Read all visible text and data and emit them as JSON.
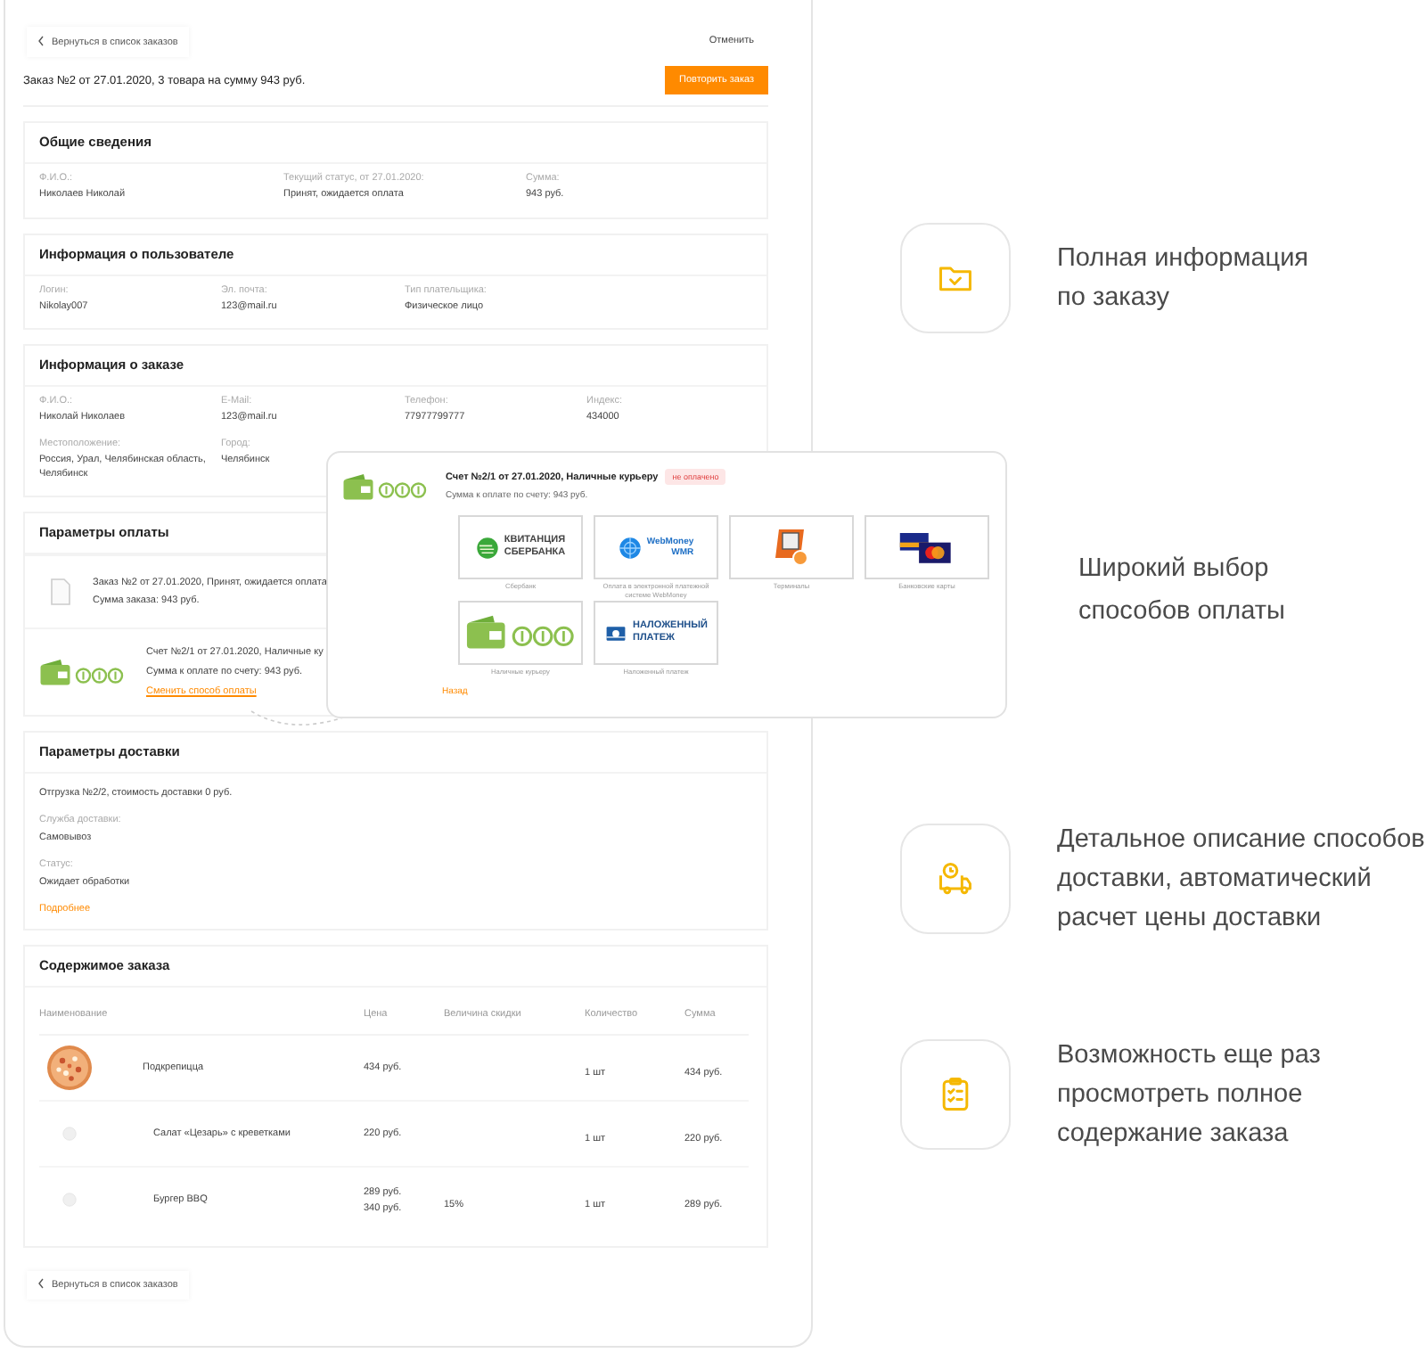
{
  "top_bar": {
    "back_link": "Вернуться в список заказов",
    "cancel_link": "Отменить"
  },
  "order_header": {
    "title": "Заказ №2 от 27.01.2020, 3 товара на сумму 943 руб.",
    "repeat_button": "Повторить заказ"
  },
  "sections": [
    {
      "kind": "summary",
      "title": "Общие сведения",
      "rows": [
        [
          {
            "label": "Ф.И.О.:",
            "value": "Николаев Николай"
          },
          {
            "label": "Текущий статус, от 27.01.2020:",
            "value": "Принят, ожидается оплата"
          },
          {
            "label": "Сумма:",
            "value": "943 руб."
          }
        ]
      ]
    },
    {
      "kind": "fields",
      "title": "Информация о пользователе",
      "rows": [
        [
          {
            "label": "Логин:",
            "value": "Nikolay007"
          },
          {
            "label": "Эл. почта:",
            "value": "123@mail.ru"
          },
          {
            "label": "Тип плательщика:",
            "value": "Физическое лицо"
          }
        ]
      ]
    },
    {
      "kind": "fields",
      "title": "Информация о заказе",
      "rows": [
        [
          {
            "label": "Ф.И.О.:",
            "value": "Николай Николаев"
          },
          {
            "label": "E-Mail:",
            "value": "123@mail.ru"
          },
          {
            "label": "Телефон:",
            "value": "77977799777"
          },
          {
            "label": "Индекс:",
            "value": "434000"
          }
        ],
        [
          {
            "label": "Местоположение:",
            "value": "Россия, Урал, Челябинская область, Челябинск"
          },
          {
            "label": "Город:",
            "value": "Челябинск"
          }
        ]
      ]
    },
    {
      "kind": "payment",
      "title": "Параметры оплаты",
      "entries": [
        {
          "kind": "document",
          "lines": [
            "Заказ №2 от 27.01.2020, Принят, ожидается оплата",
            "Сумма заказа: 943 руб."
          ]
        },
        {
          "kind": "cash",
          "lines": [
            "Счет №2/1 от 27.01.2020, Наличные ку",
            "Сумма к оплате по счету: 943 руб."
          ],
          "link": "Сменить способ оплаты"
        }
      ]
    },
    {
      "kind": "delivery",
      "title": "Параметры доставки",
      "shipment": "Отгрузка №2/2, стоимость доставки 0 руб.",
      "fields": [
        {
          "label": "Служба доставки:",
          "value": "Самовывоз"
        },
        {
          "label": "Статус:",
          "value": "Ожидает обработки"
        }
      ],
      "link": "Подробнее"
    },
    {
      "kind": "items",
      "title": "Содержимое заказа",
      "columns": [
        "Наименование",
        "Цена",
        "Величина скидки",
        "Количество",
        "Сумма"
      ],
      "rows": [
        {
          "name": "Подкрепицца",
          "prices": [
            "434 руб."
          ],
          "quantity": "1 шт",
          "sum": "434 руб."
        },
        {
          "kind": "placeholder",
          "name": "Салат «Цезарь» с креветками",
          "prices": [
            "220 руб."
          ],
          "quantity": "1 шт",
          "sum": "220 руб."
        },
        {
          "kind": "placeholder",
          "name": "Бургер BBQ",
          "prices": [
            "289 руб.",
            "340 руб."
          ],
          "discount": "15%",
          "quantity": "1 шт",
          "sum": "289 руб."
        }
      ]
    }
  ],
  "bottom_back_link": "Вернуться в список заказов",
  "payment_popup": {
    "title": "Счет №2/1 от 27.01.2020, Наличные курьеру",
    "status": "не оплачено",
    "amount": "Сумма к оплате по счету: 943 руб.",
    "methods": [
      {
        "kind": "sberbank",
        "logo_text": [
          "КВИТАНЦИЯ",
          "СБЕРБАНКА"
        ],
        "caption": "Сбербанк"
      },
      {
        "kind": "webmoney",
        "logo_text": [
          "WebMoney",
          "WMR"
        ],
        "caption": "Оплата в электронной платежной системе WebMoney"
      },
      {
        "kind": "terminal",
        "caption": "Терминалы"
      },
      {
        "kind": "cards",
        "caption": "Банковские карты"
      },
      {
        "kind": "cash",
        "caption": "Наличные курьеру"
      },
      {
        "kind": "cod",
        "logo_text": [
          "НАЛОЖЕННЫЙ",
          "ПЛАТЕЖ"
        ],
        "caption": "Наложенный платеж"
      }
    ],
    "back_link": "Назад"
  },
  "features": [
    {
      "kind": "folder",
      "lines": [
        "Полная информация",
        "по заказу"
      ]
    },
    {
      "kind": "plain",
      "lines": [
        "Широкий выбор",
        "способов оплаты"
      ]
    },
    {
      "kind": "truck",
      "lines": [
        "Детальное описание способов",
        "доставки, автоматический",
        "расчет цены доставки"
      ]
    },
    {
      "kind": "clipboard",
      "lines": [
        "Возможность еще раз",
        "просмотреть полное",
        "содержание заказа"
      ]
    }
  ]
}
